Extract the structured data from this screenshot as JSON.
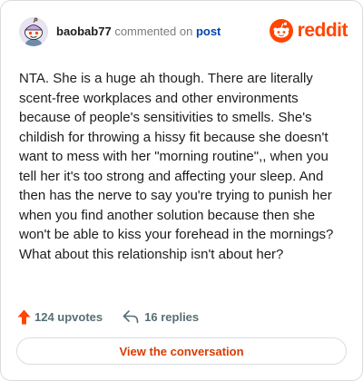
{
  "header": {
    "username": "baobab77",
    "commented_on": "commented on",
    "post_link": "post",
    "brand": "reddit"
  },
  "comment": {
    "text": "NTA. She is a huge ah though. There are literally scent-free workplaces and other environments because of people's sensitivities to smells. She's childish for throwing a hissy fit because she doesn't want to mess with her \"morning routine\",, when you tell her it's too strong and affecting your sleep. And then has the nerve to say you're trying to punish her when you find another solution because then she won't be able to kiss your forehead in the mornings? What about this relationship isn't about her?"
  },
  "stats": {
    "upvotes": "124 upvotes",
    "replies": "16 replies"
  },
  "cta": {
    "label": "View the conversation"
  },
  "icons": {
    "avatar": "snoo-avatar-icon",
    "brand": "reddit-logo-icon",
    "upvote": "upvote-arrow-icon",
    "reply": "reply-arrow-icon"
  },
  "colors": {
    "brand": "#ff4500",
    "upvote": "#ff4500",
    "link": "#0045ac",
    "cta_text": "#d93a00",
    "text": "#1c1c1c",
    "muted": "#576f76",
    "border": "#d9dcdf"
  }
}
